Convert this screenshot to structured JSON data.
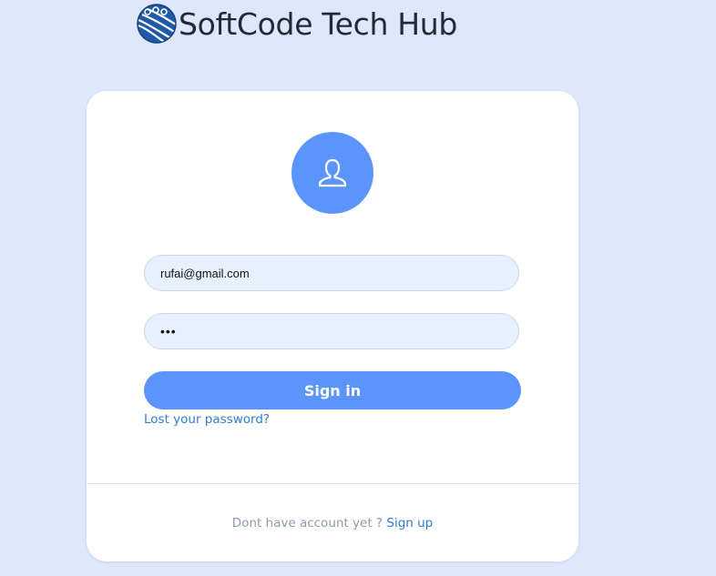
{
  "brand": {
    "title": "SoftCode Tech Hub",
    "logo_icon": "globe-logo-icon"
  },
  "login": {
    "avatar_icon": "user-icon",
    "email_value": "rufai@gmail.com",
    "password_value": "•••",
    "signin_label": "Sign in",
    "lost_password_label": "Lost your password?",
    "footer_text": "Dont have account yet ?",
    "signup_label": "Sign up"
  },
  "colors": {
    "page_background": "#dfe7fd",
    "accent": "#5b95fb",
    "link": "#2f7bd6",
    "field_background": "#e8f0fe"
  }
}
